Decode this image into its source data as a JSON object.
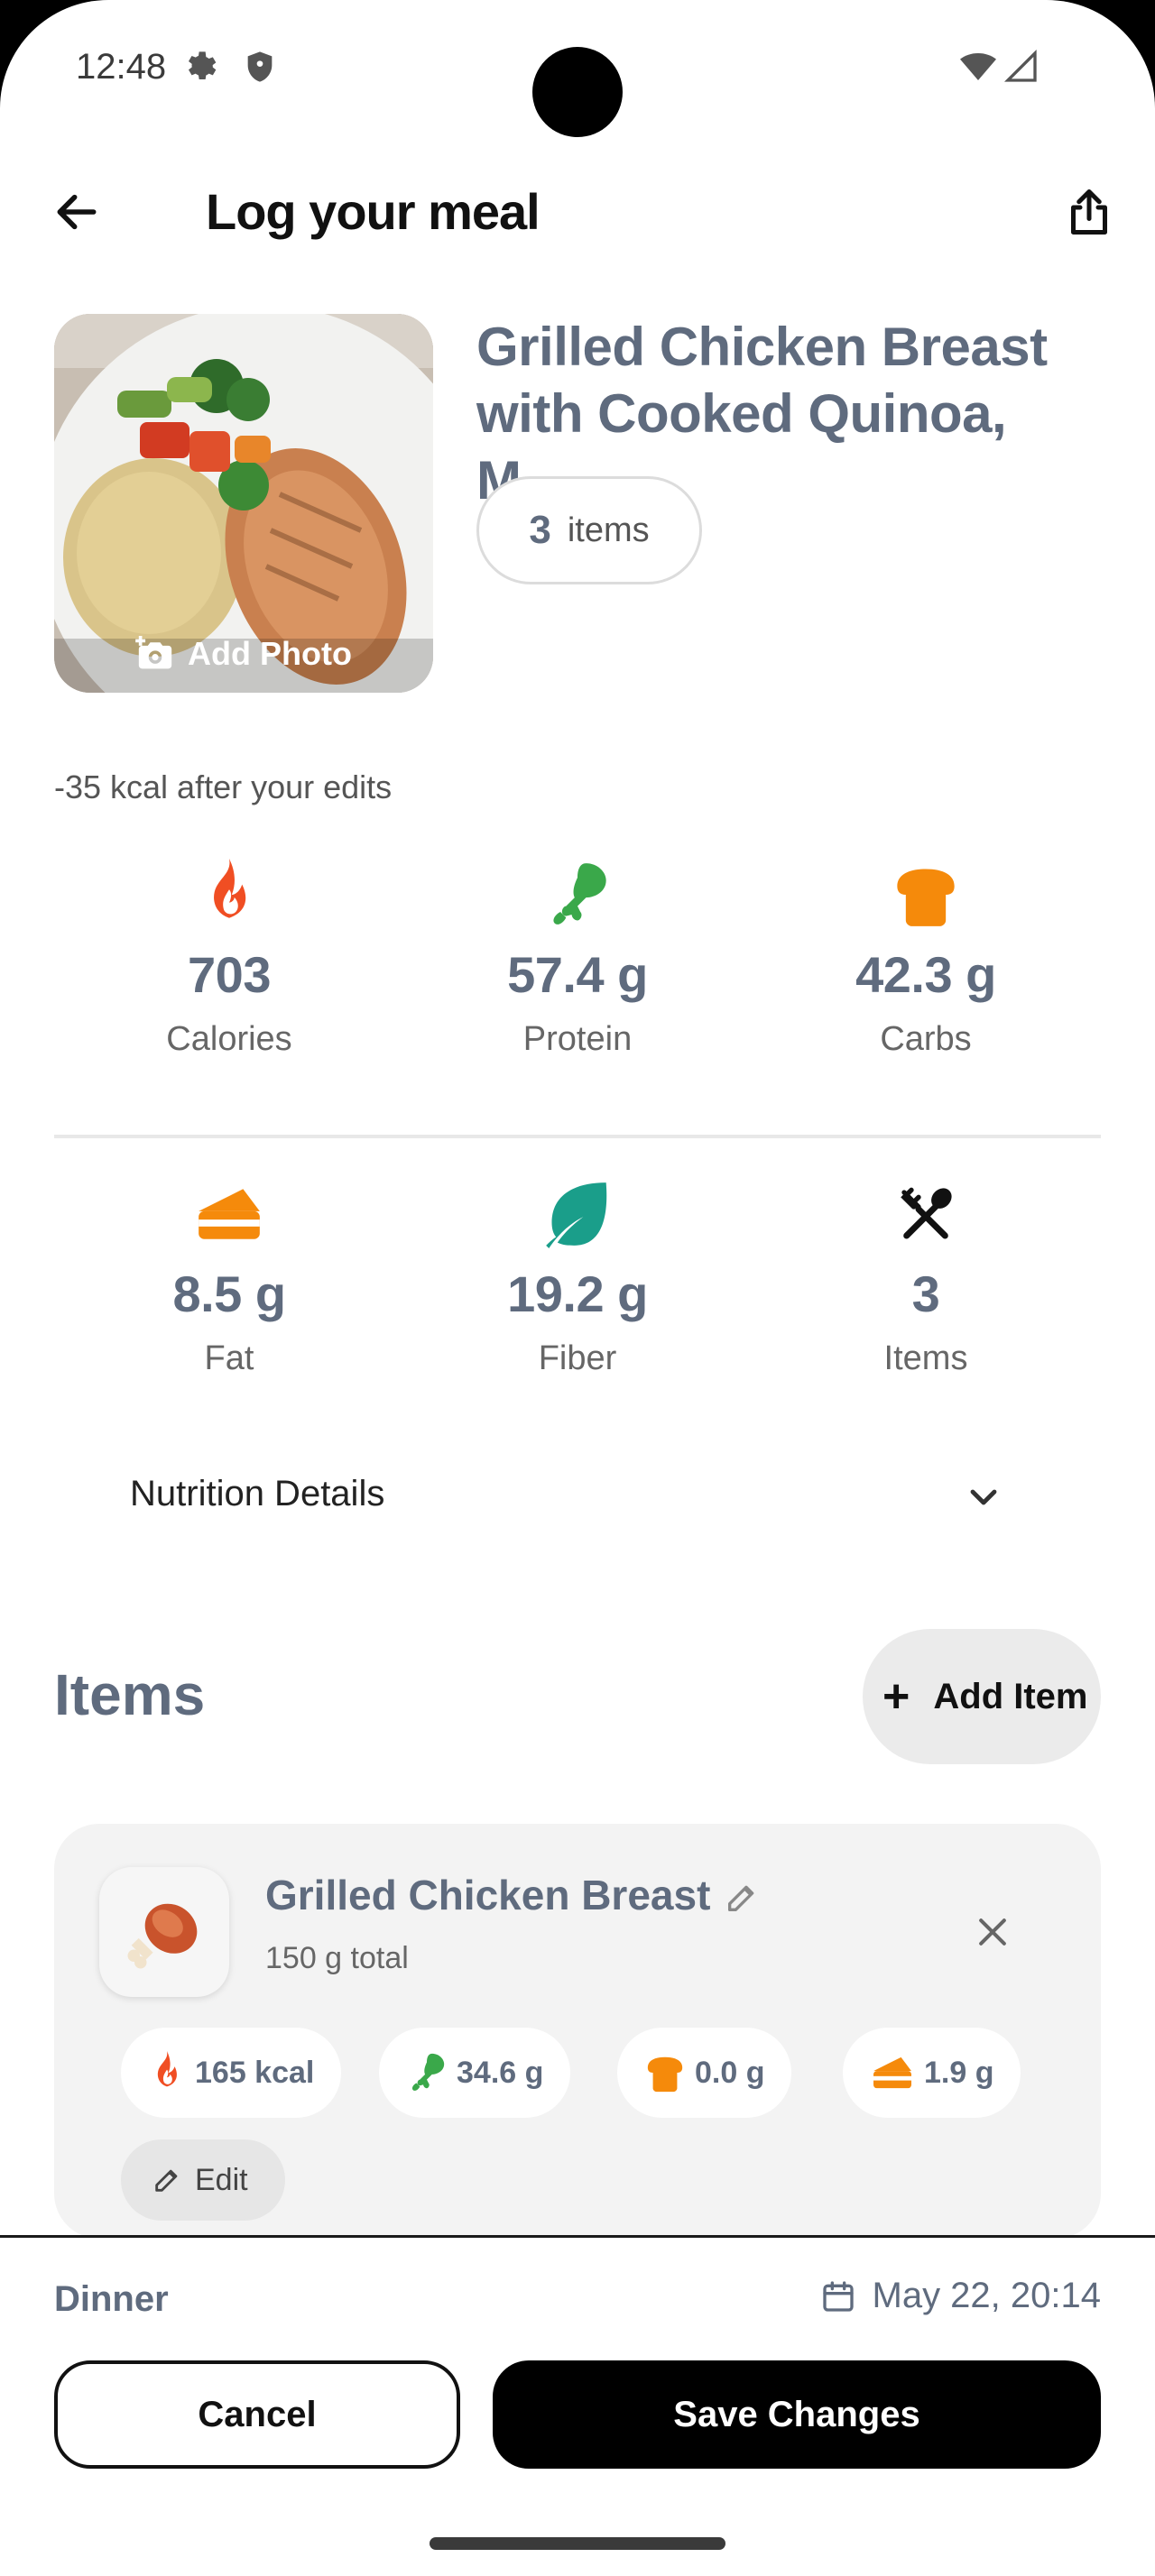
{
  "status_bar": {
    "time": "12:48",
    "icons": [
      "gear-icon",
      "shield-icon",
      "wifi-icon",
      "signal-icon"
    ]
  },
  "app_bar": {
    "title": "Log your meal",
    "back_icon": "arrow-left-icon",
    "share_icon": "share-icon"
  },
  "meal": {
    "name": "Grilled Chicken Breast with Cooked Quinoa, M...",
    "items_count": "3",
    "items_label": "items",
    "add_photo_label": "Add Photo",
    "edit_note": "-35 kcal after your edits"
  },
  "nutrition": [
    {
      "value": "703",
      "caption": "Calories",
      "icon": "flame-icon",
      "color": "#f04e23"
    },
    {
      "value": "57.4 g",
      "caption": "Protein",
      "icon": "drumstick-icon",
      "color": "#3aa84a"
    },
    {
      "value": "42.3 g",
      "caption": "Carbs",
      "icon": "bread-icon",
      "color": "#f58a0b"
    },
    {
      "value": "8.5 g",
      "caption": "Fat",
      "icon": "cheese-icon",
      "color": "#f58a0b"
    },
    {
      "value": "19.2 g",
      "caption": "Fiber",
      "icon": "leaf-icon",
      "color": "#1a9e8a"
    },
    {
      "value": "3",
      "caption": "Items",
      "icon": "utensils-icon",
      "color": "#111111"
    }
  ],
  "nutrition_details_label": "Nutrition Details",
  "items_section": {
    "heading": "Items",
    "add_item_label": "Add Item"
  },
  "item": {
    "name": "Grilled Chicken Breast",
    "subtitle": "150 g total",
    "chips": [
      {
        "icon": "flame-icon",
        "text": "165 kcal",
        "color": "#f04e23"
      },
      {
        "icon": "drumstick-icon",
        "text": "34.6 g",
        "color": "#3aa84a"
      },
      {
        "icon": "bread-icon",
        "text": "0.0 g",
        "color": "#f58a0b"
      },
      {
        "icon": "cheese-icon",
        "text": "1.9 g",
        "color": "#f58a0b"
      }
    ],
    "edit_label": "Edit"
  },
  "bottom_bar": {
    "meal_type": "Dinner",
    "datetime": "May 22, 20:14",
    "cancel_label": "Cancel",
    "save_label": "Save Changes"
  },
  "colors": {
    "accent_text": "#5f6b7e",
    "primary_button": "#000000"
  }
}
